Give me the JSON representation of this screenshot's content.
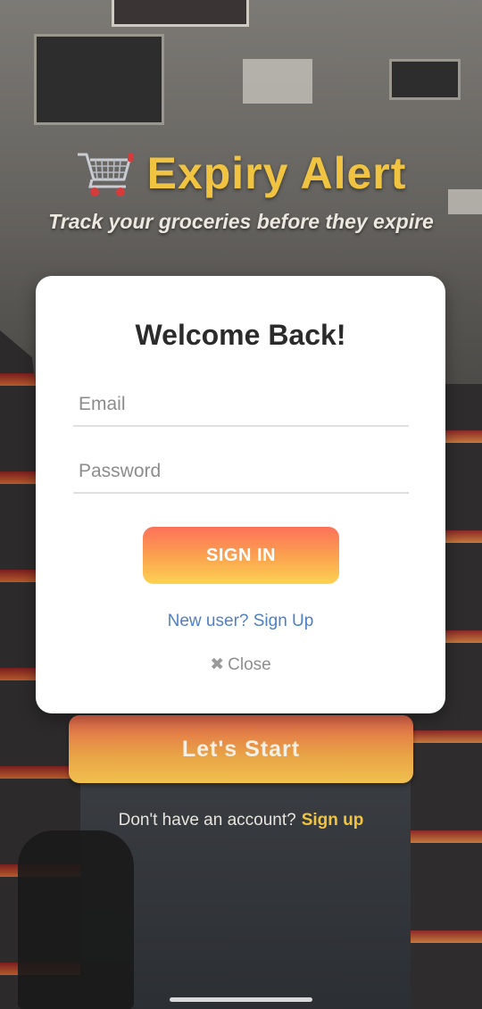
{
  "header": {
    "app_title": "Expiry Alert",
    "tagline": "Track your groceries before they expire",
    "cart_icon": "shopping-cart-icon"
  },
  "login_card": {
    "title": "Welcome Back!",
    "email_placeholder": "Email",
    "email_value": "",
    "password_placeholder": "Password",
    "password_value": "",
    "sign_in_label": "SIGN IN",
    "new_user_link": "New user? Sign Up",
    "close_label": "Close",
    "close_icon": "close-x-icon"
  },
  "behind": {
    "start_label": "Let's Start",
    "no_account_text": "Don't have an account?",
    "sign_up_link": "Sign up"
  },
  "colors": {
    "accent_yellow": "#f0c441",
    "link_blue": "#4f7fc6",
    "button_gradient_top": "#fc7159",
    "button_gradient_bottom": "#fcd250"
  }
}
